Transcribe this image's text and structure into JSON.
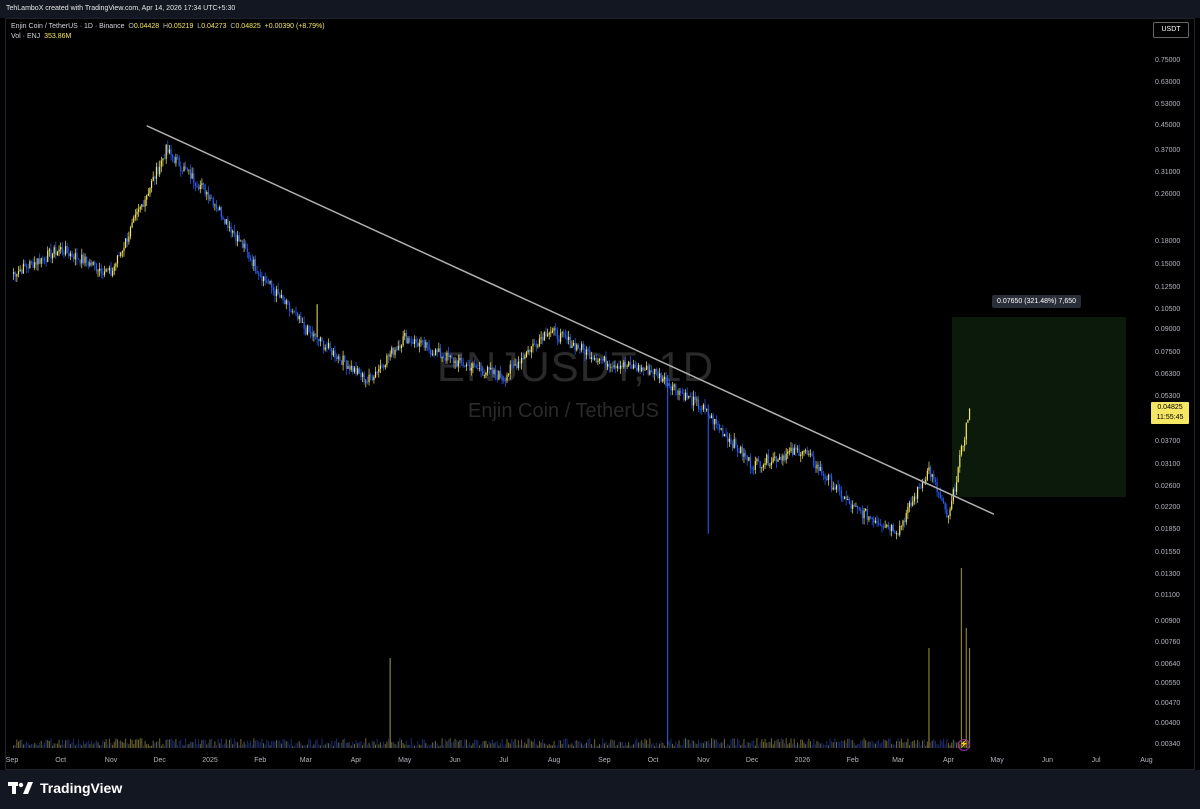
{
  "header": {
    "attribution": "TehLamboX created with TradingView.com, Apr 14, 2026 17:34 UTC+5:30"
  },
  "legend": {
    "symbol_line": "Enjin Coin / TetherUS · 1D · Binance",
    "o_label": "O",
    "o_value": "0.04428",
    "h_label": "H",
    "h_value": "0.05219",
    "l_label": "L",
    "l_value": "0.04273",
    "c_label": "C",
    "c_value": "0.04825",
    "change": "+0.00390 (+8.79%)",
    "vol_label": "Vol · ENJ",
    "vol_value": "353.86M"
  },
  "currency_badge": "USDT",
  "watermark": {
    "symbol": "ENJUSDT, 1D",
    "name": "Enjin Coin / TetherUS"
  },
  "measure_tooltip": "0.07650 (321.48%) 7,650",
  "last_price": {
    "value": "0.04825",
    "countdown": "11:55:45"
  },
  "branding": {
    "name": "TradingView"
  },
  "colors": {
    "background": "#000000",
    "up": "#f5e663",
    "down": "#2962ff",
    "trendline": "#b0b0b0",
    "measure_fill": "#0b1a0b"
  },
  "chart_data": {
    "type": "candlestick",
    "symbol": "ENJUSDT",
    "interval": "1D",
    "exchange": "Binance",
    "y_scale": "log",
    "y_ticks": [
      "0.75000",
      "0.63000",
      "0.53000",
      "0.45000",
      "0.37000",
      "0.31000",
      "0.26000",
      "0.18000",
      "0.15000",
      "0.12500",
      "0.10500",
      "0.09000",
      "0.07500",
      "0.06300",
      "0.05300",
      "0.03700",
      "0.03100",
      "0.02600",
      "0.02200",
      "0.01850",
      "0.01550",
      "0.01300",
      "0.01100",
      "0.00900",
      "0.00760",
      "0.00640",
      "0.00550",
      "0.00470",
      "0.00400",
      "0.00340"
    ],
    "x_ticks": [
      "Sep",
      "Oct",
      "Nov",
      "Dec",
      "2025",
      "Feb",
      "Mar",
      "Apr",
      "May",
      "Jun",
      "Jul",
      "Aug",
      "Sep",
      "Oct",
      "Nov",
      "Dec",
      "2026",
      "Feb",
      "Mar",
      "Apr",
      "May",
      "Jun",
      "Jul",
      "Aug"
    ],
    "price_path": [
      {
        "date": "2024-09-01",
        "close": 0.14
      },
      {
        "date": "2024-10-01",
        "close": 0.17
      },
      {
        "date": "2024-11-01",
        "close": 0.14
      },
      {
        "date": "2024-12-05",
        "close": 0.37
      },
      {
        "date": "2025-01-01",
        "close": 0.26
      },
      {
        "date": "2025-02-01",
        "close": 0.14
      },
      {
        "date": "2025-03-01",
        "close": 0.09
      },
      {
        "date": "2025-04-08",
        "close": 0.06
      },
      {
        "date": "2025-05-01",
        "close": 0.085
      },
      {
        "date": "2025-06-01",
        "close": 0.07
      },
      {
        "date": "2025-07-01",
        "close": 0.062
      },
      {
        "date": "2025-07-28",
        "close": 0.09
      },
      {
        "date": "2025-09-01",
        "close": 0.07
      },
      {
        "date": "2025-10-01",
        "close": 0.065
      },
      {
        "date": "2025-11-01",
        "close": 0.048
      },
      {
        "date": "2025-12-01",
        "close": 0.031
      },
      {
        "date": "2026-01-01",
        "close": 0.035
      },
      {
        "date": "2026-02-01",
        "close": 0.022
      },
      {
        "date": "2026-03-01",
        "close": 0.0185
      },
      {
        "date": "2026-03-20",
        "close": 0.03
      },
      {
        "date": "2026-04-01",
        "close": 0.02
      },
      {
        "date": "2026-04-14",
        "close": 0.04825
      }
    ],
    "trendline": {
      "from": {
        "date": "2024-11-23",
        "price": 0.45
      },
      "to": {
        "date": "2026-04-29",
        "price": 0.021
      }
    },
    "measure": {
      "from_price": 0.0238,
      "to_price": 0.1003,
      "change": "0.07650",
      "percent": "321.48%",
      "ticks": "7,650"
    }
  }
}
